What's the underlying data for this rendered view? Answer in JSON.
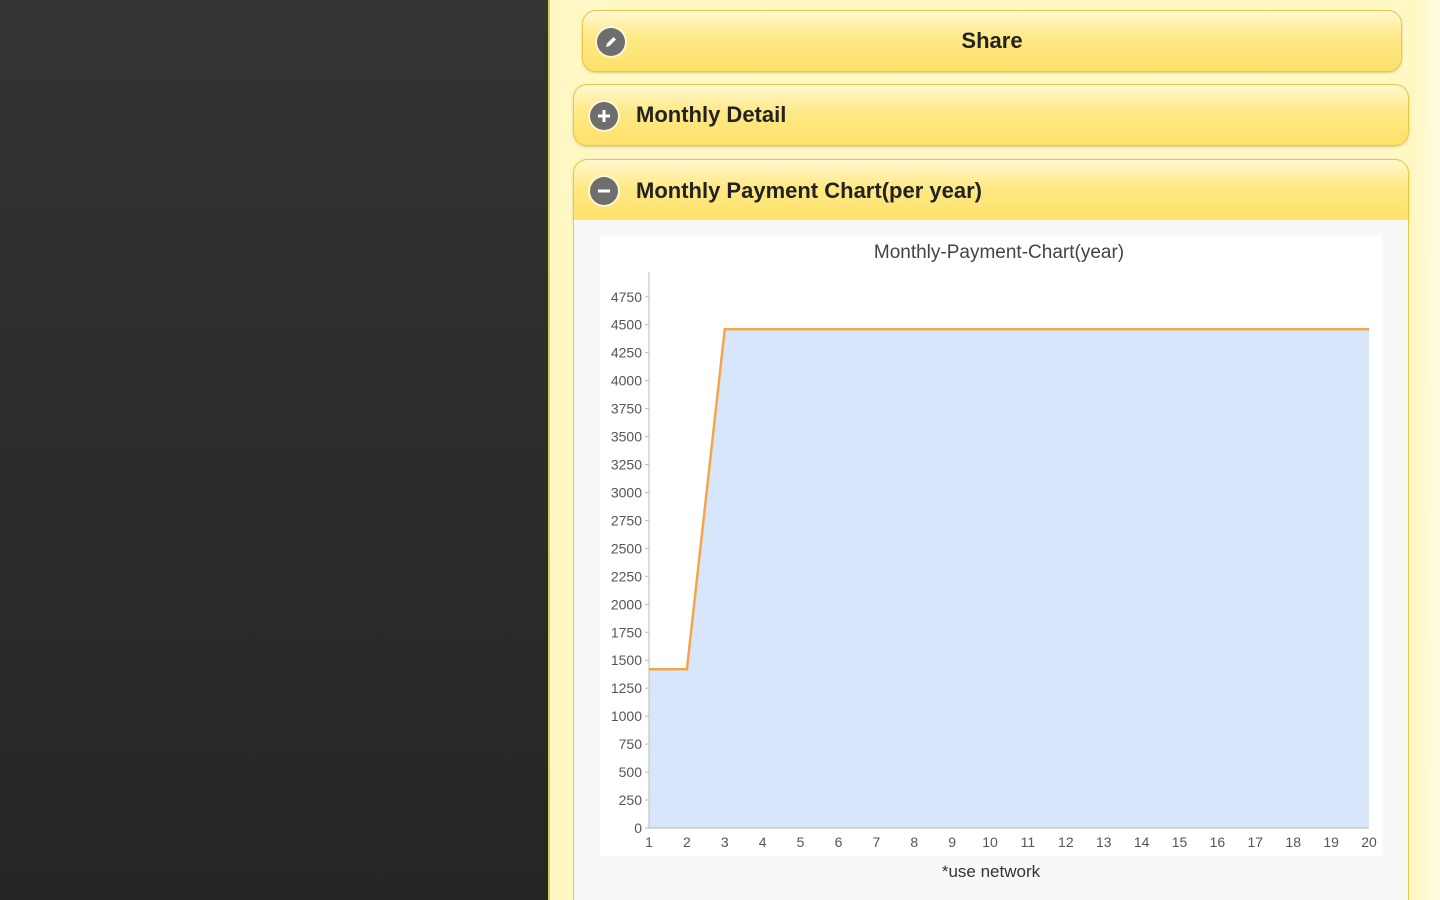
{
  "buttons": {
    "share_label": "Share"
  },
  "sections": {
    "monthly_detail_label": "Monthly Detail",
    "monthly_chart_label": "Monthly Payment Chart(per year)"
  },
  "icons": {
    "share": "pencil-icon",
    "expand": "plus-circle-icon",
    "collapse": "minus-circle-icon"
  },
  "colors": {
    "button_yellow": "#ffe985",
    "line": "#f5a54a",
    "area_fill": "#d8e6fc"
  },
  "footnote": "*use network",
  "chart_data": {
    "type": "area",
    "title": "Monthly-Payment-Chart(year)",
    "x": [
      1,
      2,
      3,
      4,
      5,
      6,
      7,
      8,
      9,
      10,
      11,
      12,
      13,
      14,
      15,
      16,
      17,
      18,
      19,
      20
    ],
    "values": [
      1420,
      1420,
      4460,
      4460,
      4460,
      4460,
      4460,
      4460,
      4460,
      4460,
      4460,
      4460,
      4460,
      4460,
      4460,
      4460,
      4460,
      4460,
      4460,
      4460
    ],
    "y_ticks": [
      0,
      250,
      500,
      750,
      1000,
      1250,
      1500,
      1750,
      2000,
      2250,
      2500,
      2750,
      3000,
      3250,
      3500,
      3750,
      4000,
      4250,
      4500,
      4750
    ],
    "xlim": [
      1,
      20
    ],
    "ylim": [
      0,
      4900
    ],
    "grid": false,
    "xlabel": "",
    "ylabel": ""
  }
}
